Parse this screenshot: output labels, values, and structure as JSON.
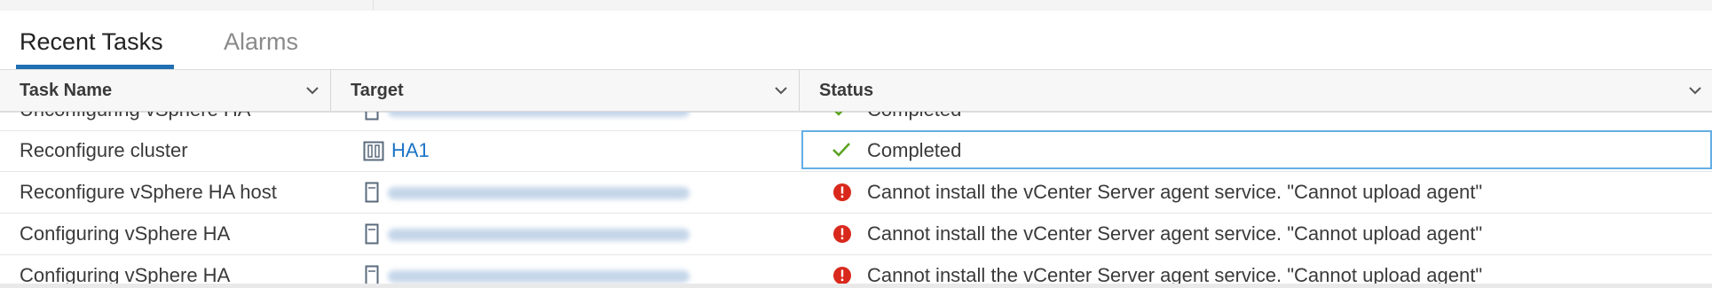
{
  "tabs": [
    {
      "label": "Recent Tasks",
      "active": true
    },
    {
      "label": "Alarms",
      "active": false
    }
  ],
  "columns": [
    {
      "label": "Task Name"
    },
    {
      "label": "Target"
    },
    {
      "label": "Status"
    }
  ],
  "rows": [
    {
      "task": "Unconfiguring vSphere HA",
      "target": "",
      "target_icon": "host-icon",
      "status": "Completed",
      "status_icon": "check-icon",
      "partial": true
    },
    {
      "task": "Reconfigure cluster",
      "target": "HA1",
      "target_icon": "cluster-icon",
      "status": "Completed",
      "status_icon": "check-icon",
      "selected": true
    },
    {
      "task": "Reconfigure vSphere HA host",
      "target": "",
      "target_icon": "host-icon",
      "status": "Cannot install the vCenter Server agent service. \"Cannot upload agent\"",
      "status_icon": "error-icon"
    },
    {
      "task": "Configuring vSphere HA",
      "target": "",
      "target_icon": "host-icon",
      "status": "Cannot install the vCenter Server agent service. \"Cannot upload agent\"",
      "status_icon": "error-icon"
    },
    {
      "task": "Configuring vSphere HA",
      "target": "",
      "target_icon": "host-icon",
      "status": "Cannot install the vCenter Server agent service. \"Cannot upload agent\"",
      "status_icon": "error-icon"
    }
  ],
  "colors": {
    "accent": "#1f6fb2",
    "link": "#1b74c7",
    "success": "#5aa220",
    "error": "#d9291c",
    "selection": "#63aee6"
  }
}
